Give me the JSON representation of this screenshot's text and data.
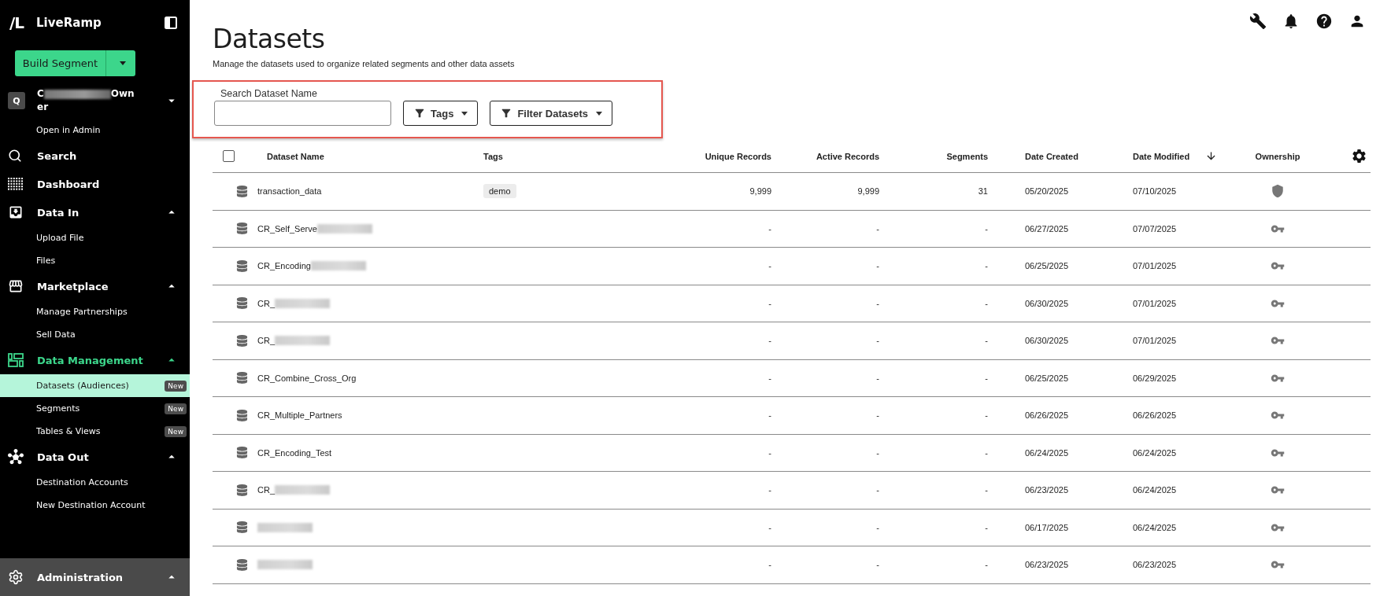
{
  "sidebar": {
    "brand_mark": "/L",
    "brand": "LiveRamp",
    "build_button": "Build Segment",
    "org": {
      "initial": "Q",
      "name_start": "C",
      "name_end": "Owner",
      "redacted": true,
      "expanded": false
    },
    "items": [
      {
        "kind": "link",
        "label": "Open in Admin",
        "selected": false
      },
      {
        "kind": "section",
        "label": "Search",
        "selected": false
      },
      {
        "kind": "section",
        "label": "Dashboard",
        "selected": false
      },
      {
        "kind": "section",
        "label": "Data In",
        "selected": false,
        "expanded": true,
        "children": [
          {
            "label": "Upload File",
            "selected": false
          },
          {
            "label": "Files",
            "selected": false
          }
        ]
      },
      {
        "kind": "section",
        "label": "Marketplace",
        "selected": false,
        "expanded": true,
        "children": [
          {
            "label": "Manage Partnerships",
            "selected": false
          },
          {
            "label": "Sell Data",
            "selected": false
          }
        ]
      },
      {
        "kind": "section",
        "label": "Data Management",
        "selected": true,
        "expanded": true,
        "children": [
          {
            "label": "Datasets (Audiences)",
            "selected": true,
            "badge": "New"
          },
          {
            "label": "Segments",
            "selected": false,
            "badge": "New"
          },
          {
            "label": "Tables & Views",
            "selected": false,
            "badge": "New"
          }
        ]
      },
      {
        "kind": "section",
        "label": "Data Out",
        "selected": false,
        "expanded": true,
        "children": [
          {
            "label": "Destination Accounts",
            "selected": false
          },
          {
            "label": "New Destination Account",
            "selected": false
          }
        ]
      }
    ],
    "footer": {
      "label": "Administration",
      "expanded": true
    }
  },
  "page": {
    "title": "Datasets",
    "subtitle": "Manage the datasets used to organize related segments and other data assets"
  },
  "filters": {
    "highlighted": true,
    "search_label": "Search Dataset Name",
    "buttons": [
      "Tags",
      "Filter Datasets"
    ]
  },
  "table": {
    "select_all": {
      "checked": false
    },
    "columns": [
      {
        "label": "Dataset Name"
      },
      {
        "label": "Tags"
      },
      {
        "label": "Unique Records"
      },
      {
        "label": "Active Records"
      },
      {
        "label": "Segments"
      },
      {
        "label": "Date Created"
      },
      {
        "label": "Date Modified",
        "sorted": true
      },
      {
        "label": "Ownership"
      }
    ],
    "rows": [
      {
        "name": "transaction_data",
        "redacted": false,
        "tag": "demo",
        "unique": "9,999",
        "active": "9,999",
        "segments": "31",
        "created": "05/20/2025",
        "modified": "07/10/2025",
        "owned": true
      },
      {
        "name": "CR_Self_Serve",
        "redacted": true,
        "unique": "-",
        "active": "-",
        "segments": "-",
        "created": "06/27/2025",
        "modified": "07/07/2025",
        "owned": false
      },
      {
        "name": "CR_Encoding",
        "redacted": true,
        "unique": "-",
        "active": "-",
        "segments": "-",
        "created": "06/25/2025",
        "modified": "07/01/2025",
        "owned": false
      },
      {
        "name": "CR_",
        "redacted": true,
        "unique": "-",
        "active": "-",
        "segments": "-",
        "created": "06/30/2025",
        "modified": "07/01/2025",
        "owned": false
      },
      {
        "name": "CR_",
        "redacted": true,
        "unique": "-",
        "active": "-",
        "segments": "-",
        "created": "06/30/2025",
        "modified": "07/01/2025",
        "owned": false
      },
      {
        "name": "CR_Combine_Cross_Org",
        "redacted": false,
        "unique": "-",
        "active": "-",
        "segments": "-",
        "created": "06/25/2025",
        "modified": "06/29/2025",
        "owned": false
      },
      {
        "name": "CR_Multiple_Partners",
        "redacted": false,
        "unique": "-",
        "active": "-",
        "segments": "-",
        "created": "06/26/2025",
        "modified": "06/26/2025",
        "owned": false
      },
      {
        "name": "CR_Encoding_Test",
        "redacted": false,
        "unique": "-",
        "active": "-",
        "segments": "-",
        "created": "06/24/2025",
        "modified": "06/24/2025",
        "owned": false
      },
      {
        "name": "CR_",
        "redacted": true,
        "unique": "-",
        "active": "-",
        "segments": "-",
        "created": "06/23/2025",
        "modified": "06/24/2025",
        "owned": false
      },
      {
        "redacted": true,
        "unique": "-",
        "active": "-",
        "segments": "-",
        "created": "06/17/2025",
        "modified": "06/24/2025",
        "owned": false
      },
      {
        "redacted": true,
        "unique": "-",
        "active": "-",
        "segments": "-",
        "created": "06/23/2025",
        "modified": "06/23/2025",
        "owned": false
      }
    ]
  }
}
